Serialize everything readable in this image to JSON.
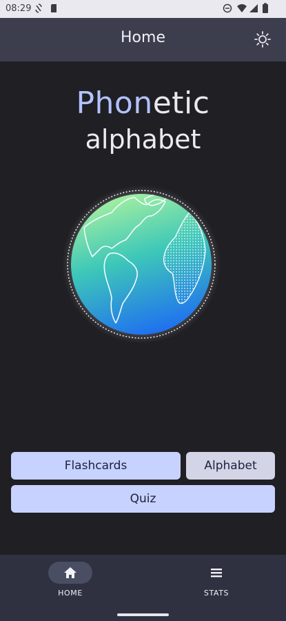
{
  "status_bar": {
    "time": "08:29"
  },
  "app_bar": {
    "title": "Home"
  },
  "hero": {
    "title_accent": "Phon",
    "title_rest": "etic",
    "subtitle": "alphabet"
  },
  "actions": {
    "flashcards": "Flashcards",
    "alphabet": "Alphabet",
    "quiz": "Quiz"
  },
  "nav": {
    "items": [
      {
        "label": "HOME",
        "icon": "home-icon",
        "selected": true
      },
      {
        "label": "STATS",
        "icon": "list-icon",
        "selected": false
      }
    ]
  },
  "colors": {
    "background": "#1f1f24",
    "app_bar": "#3c3e4e",
    "accent": "#b3c2ff",
    "button_primary": "#c8d2ff",
    "button_secondary": "#d3d5e6",
    "nav_bar": "#2f3140"
  }
}
